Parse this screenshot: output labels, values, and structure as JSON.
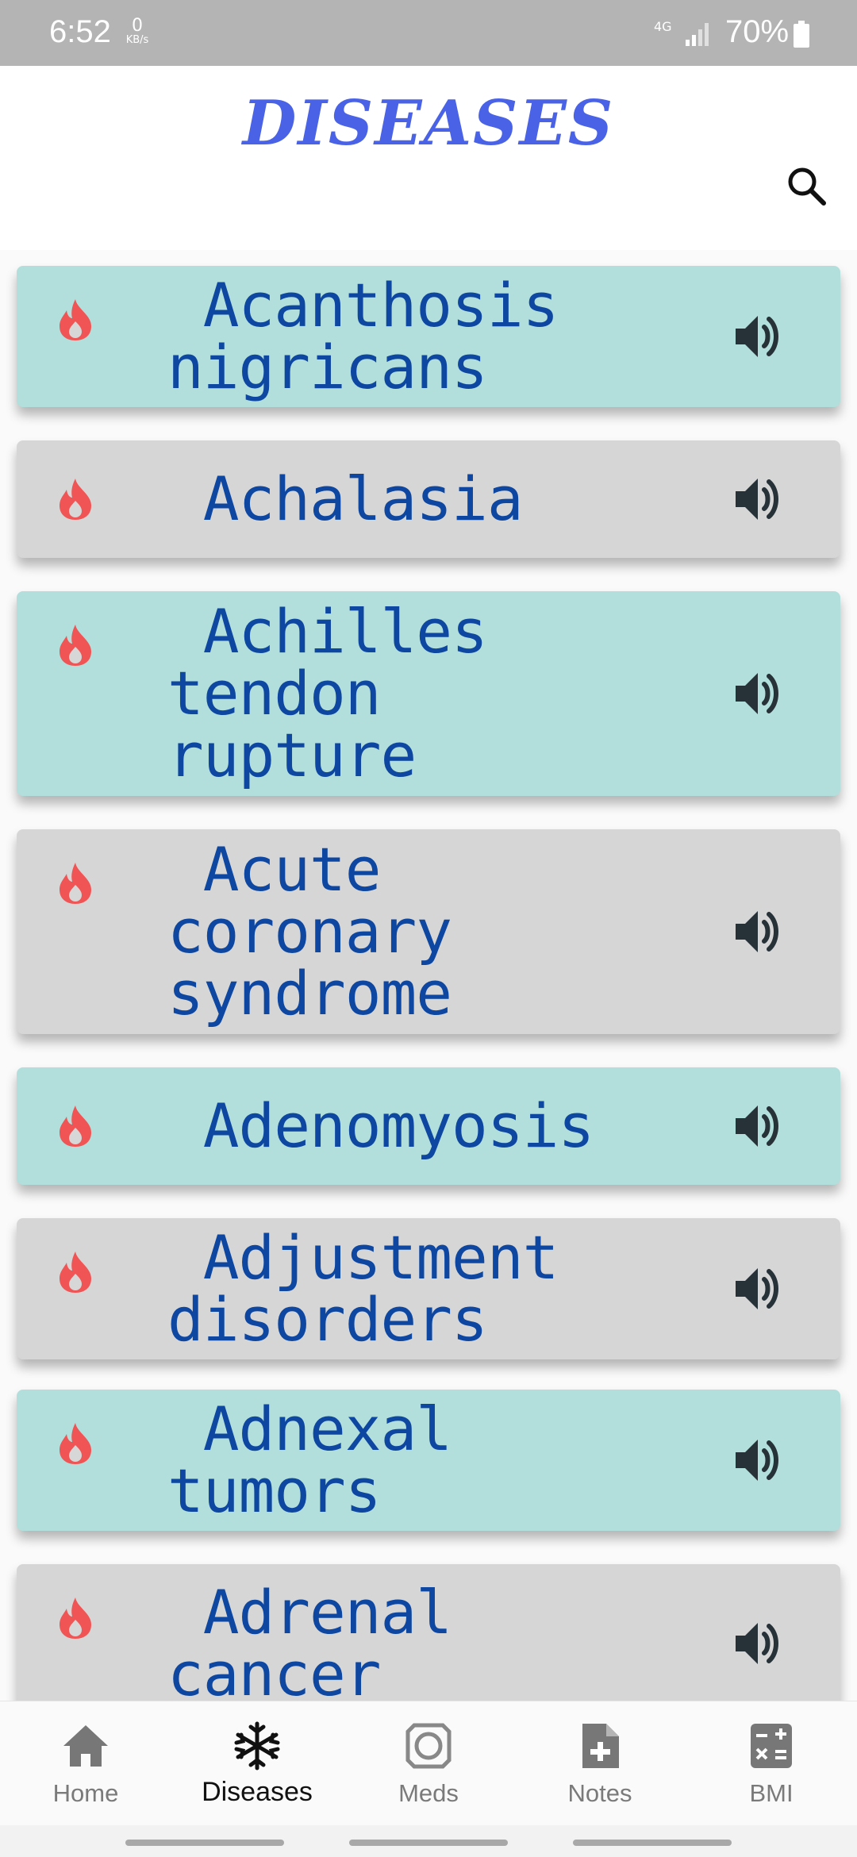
{
  "status_bar": {
    "time": "6:52",
    "net_speed_value": "0",
    "net_speed_unit": "KB/s",
    "network_type": "4G",
    "battery": "70%",
    "icons": [
      "signal-icon",
      "battery-icon"
    ]
  },
  "header": {
    "title": "DISEASES",
    "search_icon": "search-icon"
  },
  "diseases": [
    {
      "name": " Acanthosis\nnigricans",
      "style": "teal"
    },
    {
      "name": " Achalasia",
      "style": "gray"
    },
    {
      "name": " Achilles\ntendon\nrupture",
      "style": "teal"
    },
    {
      "name": " Acute\ncoronary\nsyndrome",
      "style": "gray"
    },
    {
      "name": " Adenomyosis",
      "style": "teal"
    },
    {
      "name": " Adjustment\ndisorders",
      "style": "gray"
    },
    {
      "name": " Adnexal\ntumors",
      "style": "teal"
    },
    {
      "name": " Adrenal\ncancer",
      "style": "gray"
    }
  ],
  "nav": {
    "items": [
      {
        "label": "Home",
        "icon": "home-icon",
        "active": false
      },
      {
        "label": "Diseases",
        "icon": "snowflake-icon",
        "active": true
      },
      {
        "label": "Meds",
        "icon": "pill-icon",
        "active": false
      },
      {
        "label": "Notes",
        "icon": "note-add-icon",
        "active": false
      },
      {
        "label": "BMI",
        "icon": "calculator-icon",
        "active": false
      }
    ]
  },
  "colors": {
    "title": "#4a63e6",
    "card_teal": "#b2dfdb",
    "card_gray": "#d6d6d6",
    "disease_text": "#0d47a1",
    "flame": "#f05454",
    "status_bar": "#b4b4b4"
  }
}
